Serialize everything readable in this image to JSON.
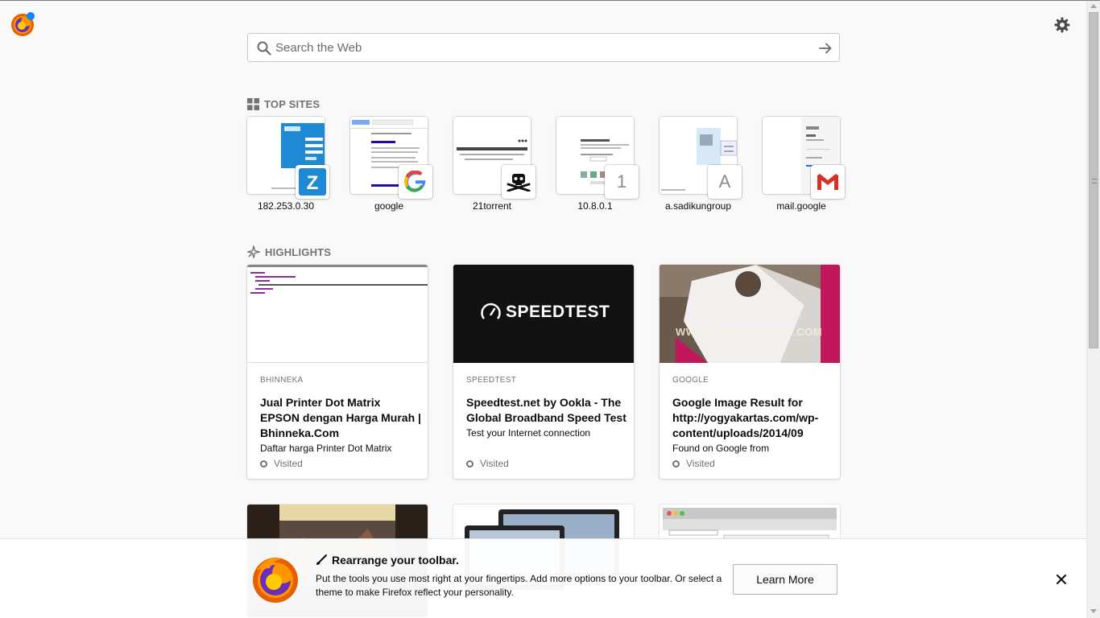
{
  "search": {
    "placeholder": "Search the Web"
  },
  "top_sites": {
    "title": "TOP SITES",
    "tiles": [
      {
        "label": "182.253.0.30",
        "icon": "zimbra-z-icon"
      },
      {
        "label": "google",
        "icon": "google-g-icon"
      },
      {
        "label": "21torrent",
        "icon": "pirate-icon"
      },
      {
        "label": "10.8.0.1",
        "fallback_letter": "1"
      },
      {
        "label": "a.sadikungroup",
        "fallback_letter": "A"
      },
      {
        "label": "mail.google",
        "icon": "gmail-icon"
      }
    ]
  },
  "highlights": {
    "title": "HIGHLIGHTS",
    "cards": [
      {
        "source": "BHINNEKA",
        "title": "Jual Printer Dot Matrix EPSON dengan Harga Murah | Bhinneka.Com",
        "description": "Daftar harga Printer Dot Matrix",
        "context": "Visited"
      },
      {
        "source": "SPEEDTEST",
        "title": "Speedtest.net by Ookla - The Global Broadband Speed Test",
        "description": "Test your Internet connection",
        "context": "Visited",
        "image_text": "SPEEDTEST"
      },
      {
        "source": "GOOGLE",
        "title": "Google Image Result for http://yogyakartas.com/wp-content/uploads/2014/09",
        "description": "Found on Google from",
        "context": "Visited",
        "image_text": "WWW.YOGYAKARTAS.COM"
      }
    ]
  },
  "snippet": {
    "title": "Rearrange your toolbar.",
    "text": "Put the tools you use most right at your fingertips. Add more options to your toolbar. Or select a theme to make Firefox reflect your personality.",
    "button": "Learn More"
  },
  "colors": {
    "background": "#f9f9fa",
    "muted": "#737373",
    "accent": "#0a84ff"
  }
}
